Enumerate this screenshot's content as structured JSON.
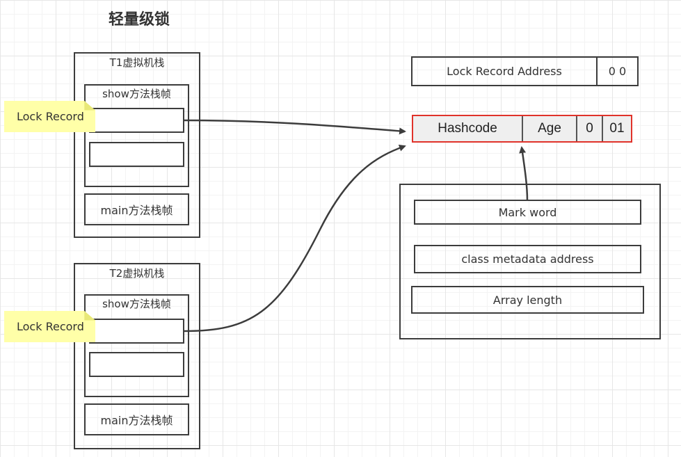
{
  "title": "轻量级锁",
  "threads": [
    {
      "stack_label": "T1虚拟机栈",
      "show_frame": "show方法栈帧",
      "main_frame": "main方法栈帧",
      "note": "Lock Record"
    },
    {
      "stack_label": "T2虚拟机栈",
      "show_frame": "show方法栈帧",
      "main_frame": "main方法栈帧",
      "note": "Lock Record"
    }
  ],
  "lock_record_address": {
    "label": "Lock Record Address",
    "bits": "0 0"
  },
  "mark_word_bits": {
    "hashcode": "Hashcode",
    "age": "Age",
    "biased": "0",
    "lock": "01"
  },
  "object_header": {
    "mark_word": "Mark word",
    "class_metadata": "class metadata address",
    "array_length": "Array length"
  },
  "colors": {
    "highlight_border": "#e0322a",
    "note_bg": "#ffffa8",
    "line": "#3c3c3c"
  }
}
